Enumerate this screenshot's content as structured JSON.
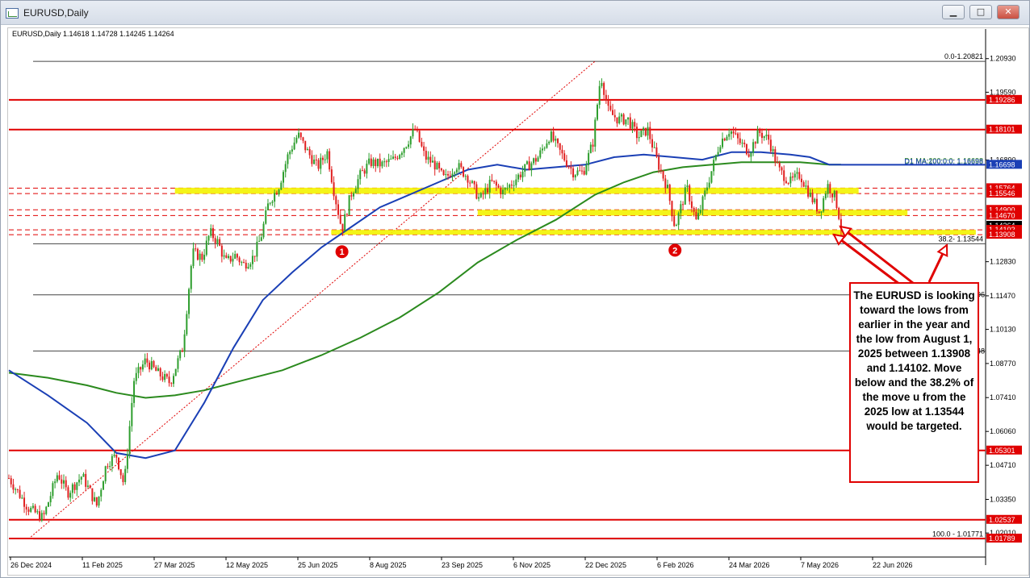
{
  "window": {
    "title": "EURUSD,Daily",
    "buttons": {
      "minimize": "▁",
      "maximize": "□",
      "close": "✕"
    }
  },
  "ohlc_header": "EURUSD,Daily  1.14618 1.14728 1.14245 1.14264",
  "annotation": {
    "text": "The EURUSD is looking toward the lows from earlier in the year and the low from August 1, 2025 between 1.13908 and 1.14102.  Move below and the 38.2% of the move u from the 2025 low at 1.13544 would be targeted."
  },
  "markers": [
    "1",
    "2"
  ],
  "chart_data": {
    "type": "candlestick",
    "symbol": "EURUSD",
    "timeframe": "Daily",
    "ohlc": {
      "open": 1.14618,
      "high": 1.14728,
      "low": 1.14245,
      "close": 1.14264
    },
    "ylim": [
      1.0105,
      1.2195
    ],
    "x_tick_labels": [
      "26 Dec 2024",
      "11 Feb 2025",
      "27 Mar 2025",
      "12 May 2025",
      "25 Jun 2025",
      "8 Aug 2025",
      "23 Sep 2025",
      "6 Nov 2025",
      "22 Dec 2025",
      "6 Feb 2026",
      "24 Mar 2026",
      "7 May 2026",
      "22 Jun 2026"
    ],
    "y_tick_labels": [
      {
        "value": 1.2093,
        "label": "1.20930"
      },
      {
        "value": 1.1959,
        "label": "1.19590"
      },
      {
        "value": 1.1689,
        "label": "1.16890"
      },
      {
        "value": 1.1283,
        "label": "1.12830"
      },
      {
        "value": 1.1147,
        "label": "1.11470"
      },
      {
        "value": 1.1013,
        "label": "1.10130"
      },
      {
        "value": 1.0877,
        "label": "1.08770"
      },
      {
        "value": 1.0741,
        "label": "1.07410"
      },
      {
        "value": 1.0606,
        "label": "1.06060"
      },
      {
        "value": 1.0471,
        "label": "1.04710"
      },
      {
        "value": 1.0335,
        "label": "1.03350"
      },
      {
        "value": 1.0201,
        "label": "1.02010"
      }
    ],
    "price_labels": [
      {
        "value": 1.19286,
        "label": "1.19286",
        "color": "#e00000"
      },
      {
        "value": 1.18101,
        "label": "1.18101",
        "color": "#e00000"
      },
      {
        "value": 1.16698,
        "label": "1.16698",
        "color": "#1a3fb5"
      },
      {
        "value": 1.15764,
        "label": "1.15764",
        "color": "#e00000"
      },
      {
        "value": 1.15546,
        "label": "1.15546",
        "color": "#e00000"
      },
      {
        "value": 1.149,
        "label": "1.14900",
        "color": "#e00000"
      },
      {
        "value": 1.1467,
        "label": "1.14670",
        "color": "#e00000"
      },
      {
        "value": 1.14264,
        "label": "1.14264",
        "color": "#000000"
      },
      {
        "value": 1.14102,
        "label": "1.14102",
        "color": "#e00000"
      },
      {
        "value": 1.13908,
        "label": "1.13908",
        "color": "#e00000"
      },
      {
        "value": 1.05301,
        "label": "1.05301",
        "color": "#e00000"
      },
      {
        "value": 1.02537,
        "label": "1.02537",
        "color": "#e00000"
      },
      {
        "value": 1.01789,
        "label": "1.01789",
        "color": "#e00000"
      }
    ],
    "horizontal_lines": [
      {
        "value": 1.19286,
        "color": "#e00000",
        "style": "solid"
      },
      {
        "value": 1.18101,
        "color": "#e00000",
        "style": "solid"
      },
      {
        "value": 1.15764,
        "color": "#e00000",
        "style": "dashed"
      },
      {
        "value": 1.15546,
        "color": "#e00000",
        "style": "dashed"
      },
      {
        "value": 1.149,
        "color": "#e00000",
        "style": "dashed"
      },
      {
        "value": 1.1467,
        "color": "#e00000",
        "style": "dashed"
      },
      {
        "value": 1.14102,
        "color": "#e00000",
        "style": "dashed"
      },
      {
        "value": 1.13908,
        "color": "#e00000",
        "style": "dashed"
      },
      {
        "value": 1.05301,
        "color": "#e00000",
        "style": "solid"
      },
      {
        "value": 1.02537,
        "color": "#e00000",
        "style": "solid"
      },
      {
        "value": 1.01789,
        "color": "#e00000",
        "style": "solid"
      }
    ],
    "fibonacci": {
      "color": "#444444",
      "levels": [
        {
          "value": 1.20821,
          "label": "0.0-1.20821"
        },
        {
          "value": 1.13544,
          "label": "38.2- 1.13544"
        },
        {
          "value": 1.1151,
          "label": ""
        },
        {
          "value": 1.0927,
          "label": ""
        },
        {
          "value": 1.01771,
          "label": "100.0 - 1.01771"
        }
      ],
      "trend_line": {
        "from": [
          0.02,
          1.01771
        ],
        "to": [
          0.6,
          1.20821
        ]
      }
    },
    "zones": [
      {
        "from": 1.1554,
        "to": 1.1578,
        "x_start": 0.17,
        "x_end": 0.87
      },
      {
        "from": 1.1467,
        "to": 1.149,
        "x_start": 0.48,
        "x_end": 0.92
      },
      {
        "from": 1.1391,
        "to": 1.141,
        "x_start": 0.33,
        "x_end": 0.99
      }
    ],
    "ma_labels": {
      "ma200": "D1 MA:200:0:0: 1.16698",
      "ma100": "D1 MA:100:0:0: 1.16698"
    },
    "edge_labels": [
      {
        "value": 1.1151,
        "label": "96"
      },
      {
        "value": 1.0927,
        "label": "48"
      }
    ],
    "markers": [
      {
        "label": "1",
        "x": 0.341,
        "value": 1.1355
      },
      {
        "label": "2",
        "x": 0.682,
        "value": 1.1361
      }
    ],
    "series": [
      {
        "type": "candles",
        "color_up": "#2e9e2e",
        "color_down": "#e02020"
      },
      {
        "type": "moving_average",
        "period": 100,
        "color": "#1a3fb5"
      },
      {
        "type": "moving_average",
        "period": 200,
        "color": "#2b8a1e"
      }
    ],
    "close_path": [
      [
        0.0,
        1.042
      ],
      [
        0.02,
        1.03
      ],
      [
        0.035,
        1.026
      ],
      [
        0.05,
        1.044
      ],
      [
        0.06,
        1.036
      ],
      [
        0.075,
        1.043
      ],
      [
        0.09,
        1.031
      ],
      [
        0.1,
        1.048
      ],
      [
        0.11,
        1.051
      ],
      [
        0.118,
        1.039
      ],
      [
        0.128,
        1.081
      ],
      [
        0.14,
        1.089
      ],
      [
        0.152,
        1.084
      ],
      [
        0.165,
        1.08
      ],
      [
        0.178,
        1.094
      ],
      [
        0.188,
        1.132
      ],
      [
        0.198,
        1.13
      ],
      [
        0.206,
        1.14
      ],
      [
        0.214,
        1.136
      ],
      [
        0.222,
        1.128
      ],
      [
        0.232,
        1.131
      ],
      [
        0.24,
        1.127
      ],
      [
        0.25,
        1.13
      ],
      [
        0.258,
        1.138
      ],
      [
        0.266,
        1.152
      ],
      [
        0.276,
        1.158
      ],
      [
        0.286,
        1.171
      ],
      [
        0.296,
        1.179
      ],
      [
        0.306,
        1.172
      ],
      [
        0.316,
        1.166
      ],
      [
        0.326,
        1.172
      ],
      [
        0.333,
        1.156
      ],
      [
        0.341,
        1.141
      ],
      [
        0.35,
        1.155
      ],
      [
        0.36,
        1.163
      ],
      [
        0.37,
        1.168
      ],
      [
        0.382,
        1.167
      ],
      [
        0.394,
        1.169
      ],
      [
        0.406,
        1.175
      ],
      [
        0.416,
        1.181
      ],
      [
        0.426,
        1.17
      ],
      [
        0.436,
        1.167
      ],
      [
        0.446,
        1.161
      ],
      [
        0.458,
        1.167
      ],
      [
        0.47,
        1.162
      ],
      [
        0.482,
        1.153
      ],
      [
        0.494,
        1.16
      ],
      [
        0.506,
        1.156
      ],
      [
        0.518,
        1.161
      ],
      [
        0.53,
        1.166
      ],
      [
        0.542,
        1.17
      ],
      [
        0.554,
        1.179
      ],
      [
        0.566,
        1.171
      ],
      [
        0.578,
        1.164
      ],
      [
        0.588,
        1.164
      ],
      [
        0.598,
        1.176
      ],
      [
        0.606,
        1.203
      ],
      [
        0.614,
        1.188
      ],
      [
        0.624,
        1.185
      ],
      [
        0.634,
        1.185
      ],
      [
        0.644,
        1.178
      ],
      [
        0.654,
        1.181
      ],
      [
        0.664,
        1.168
      ],
      [
        0.674,
        1.158
      ],
      [
        0.682,
        1.142
      ],
      [
        0.694,
        1.158
      ],
      [
        0.704,
        1.144
      ],
      [
        0.716,
        1.16
      ],
      [
        0.728,
        1.176
      ],
      [
        0.738,
        1.181
      ],
      [
        0.748,
        1.176
      ],
      [
        0.758,
        1.172
      ],
      [
        0.768,
        1.18
      ],
      [
        0.778,
        1.177
      ],
      [
        0.788,
        1.165
      ],
      [
        0.8,
        1.16
      ],
      [
        0.81,
        1.163
      ],
      [
        0.82,
        1.155
      ],
      [
        0.83,
        1.148
      ],
      [
        0.838,
        1.159
      ],
      [
        0.846,
        1.154
      ],
      [
        0.852,
        1.1426
      ]
    ],
    "ma100_path": [
      [
        0.0,
        1.085
      ],
      [
        0.04,
        1.075
      ],
      [
        0.08,
        1.064
      ],
      [
        0.11,
        1.052
      ],
      [
        0.14,
        1.05
      ],
      [
        0.17,
        1.053
      ],
      [
        0.2,
        1.072
      ],
      [
        0.23,
        1.094
      ],
      [
        0.26,
        1.113
      ],
      [
        0.29,
        1.124
      ],
      [
        0.32,
        1.134
      ],
      [
        0.35,
        1.142
      ],
      [
        0.38,
        1.15
      ],
      [
        0.41,
        1.155
      ],
      [
        0.44,
        1.16
      ],
      [
        0.47,
        1.165
      ],
      [
        0.5,
        1.167
      ],
      [
        0.53,
        1.165
      ],
      [
        0.56,
        1.166
      ],
      [
        0.59,
        1.167
      ],
      [
        0.62,
        1.17
      ],
      [
        0.65,
        1.171
      ],
      [
        0.68,
        1.17
      ],
      [
        0.71,
        1.169
      ],
      [
        0.74,
        1.172
      ],
      [
        0.77,
        1.172
      ],
      [
        0.8,
        1.171
      ],
      [
        0.82,
        1.17
      ],
      [
        0.84,
        1.167
      ],
      [
        0.852,
        1.16698
      ]
    ],
    "ma200_path": [
      [
        0.0,
        1.084
      ],
      [
        0.04,
        1.082
      ],
      [
        0.08,
        1.079
      ],
      [
        0.11,
        1.076
      ],
      [
        0.14,
        1.074
      ],
      [
        0.17,
        1.075
      ],
      [
        0.2,
        1.077
      ],
      [
        0.24,
        1.081
      ],
      [
        0.28,
        1.085
      ],
      [
        0.32,
        1.091
      ],
      [
        0.36,
        1.098
      ],
      [
        0.4,
        1.106
      ],
      [
        0.44,
        1.116
      ],
      [
        0.48,
        1.128
      ],
      [
        0.52,
        1.137
      ],
      [
        0.56,
        1.145
      ],
      [
        0.6,
        1.155
      ],
      [
        0.63,
        1.16
      ],
      [
        0.66,
        1.164
      ],
      [
        0.69,
        1.166
      ],
      [
        0.72,
        1.167
      ],
      [
        0.75,
        1.168
      ],
      [
        0.78,
        1.168
      ],
      [
        0.81,
        1.168
      ],
      [
        0.84,
        1.167
      ],
      [
        0.852,
        1.16698
      ]
    ]
  }
}
